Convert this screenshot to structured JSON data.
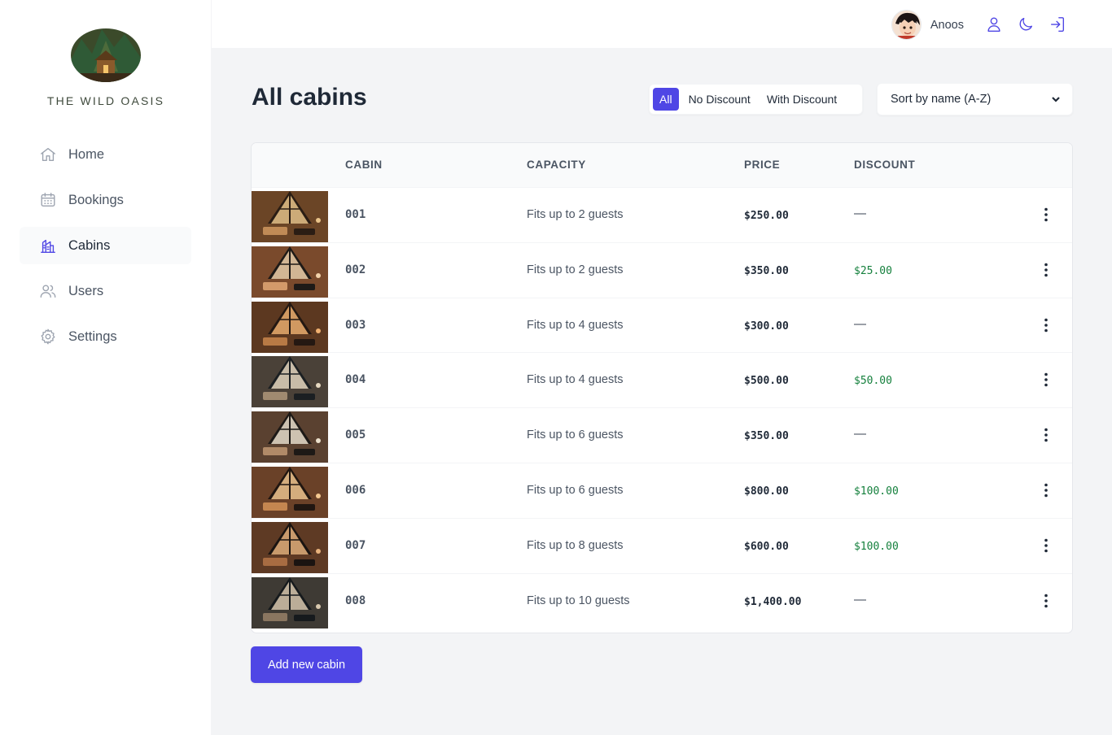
{
  "brand": {
    "name": "THE WILD OASIS"
  },
  "sidebar": {
    "items": [
      {
        "label": "Home",
        "icon": "home-icon"
      },
      {
        "label": "Bookings",
        "icon": "calendar-icon"
      },
      {
        "label": "Cabins",
        "icon": "cabins-icon",
        "active": true
      },
      {
        "label": "Users",
        "icon": "users-icon"
      },
      {
        "label": "Settings",
        "icon": "gear-icon"
      }
    ]
  },
  "header": {
    "user_name": "Anoos",
    "icons": [
      "user-icon",
      "moon-icon",
      "logout-icon"
    ]
  },
  "main": {
    "title": "All cabins",
    "filter": {
      "options": [
        "All",
        "No Discount",
        "With Discount"
      ],
      "selected": "All"
    },
    "sort": {
      "selected": "Sort by name (A-Z)"
    },
    "table": {
      "columns": [
        "",
        "CABIN",
        "CAPACITY",
        "PRICE",
        "DISCOUNT"
      ],
      "rows": [
        {
          "name": "001",
          "capacity": "Fits up to 2 guests",
          "price": "$250.00",
          "discount": "—"
        },
        {
          "name": "002",
          "capacity": "Fits up to 2 guests",
          "price": "$350.00",
          "discount": "$25.00"
        },
        {
          "name": "003",
          "capacity": "Fits up to 4 guests",
          "price": "$300.00",
          "discount": "—"
        },
        {
          "name": "004",
          "capacity": "Fits up to 4 guests",
          "price": "$500.00",
          "discount": "$50.00"
        },
        {
          "name": "005",
          "capacity": "Fits up to 6 guests",
          "price": "$350.00",
          "discount": "—"
        },
        {
          "name": "006",
          "capacity": "Fits up to 6 guests",
          "price": "$800.00",
          "discount": "$100.00"
        },
        {
          "name": "007",
          "capacity": "Fits up to 8 guests",
          "price": "$600.00",
          "discount": "$100.00"
        },
        {
          "name": "008",
          "capacity": "Fits up to 10 guests",
          "price": "$1,400.00",
          "discount": "—"
        }
      ]
    },
    "add_button": "Add new cabin"
  },
  "colors": {
    "accent": "#4f46e5",
    "discount": "#15803d",
    "background": "#f3f4f6"
  }
}
